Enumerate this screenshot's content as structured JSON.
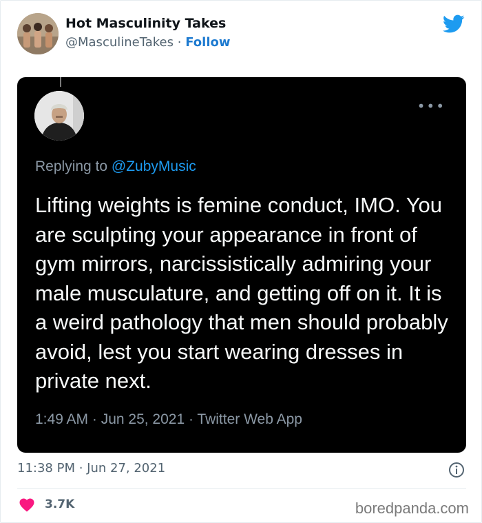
{
  "author": {
    "display_name": "Hot Masculinity Takes",
    "handle": "@MasculineTakes",
    "separator": "·",
    "follow_label": "Follow"
  },
  "embedded_tweet": {
    "replying_prefix": "Replying to",
    "replying_handle": "@ZubyMusic",
    "text": "Lifting weights is femine conduct, IMO. You are sculpting your appearance in front of gym mirrors, narcissistically admiring your male musculature, and getting off on it. It is a weird pathology that men should probably avoid, lest you start wearing dresses in private next.",
    "meta": "1:49 AM · Jun 25, 2021 · Twitter Web App"
  },
  "timestamp": "11:38 PM · Jun 27, 2021",
  "likes": "3.7K",
  "watermark": "boredpanda.com",
  "colors": {
    "twitter_blue": "#1d9bf0",
    "heart_red": "#f91880",
    "dark_bg": "#000000"
  },
  "icons": [
    "twitter-bird-icon",
    "more-dots-icon",
    "info-icon",
    "heart-icon"
  ]
}
